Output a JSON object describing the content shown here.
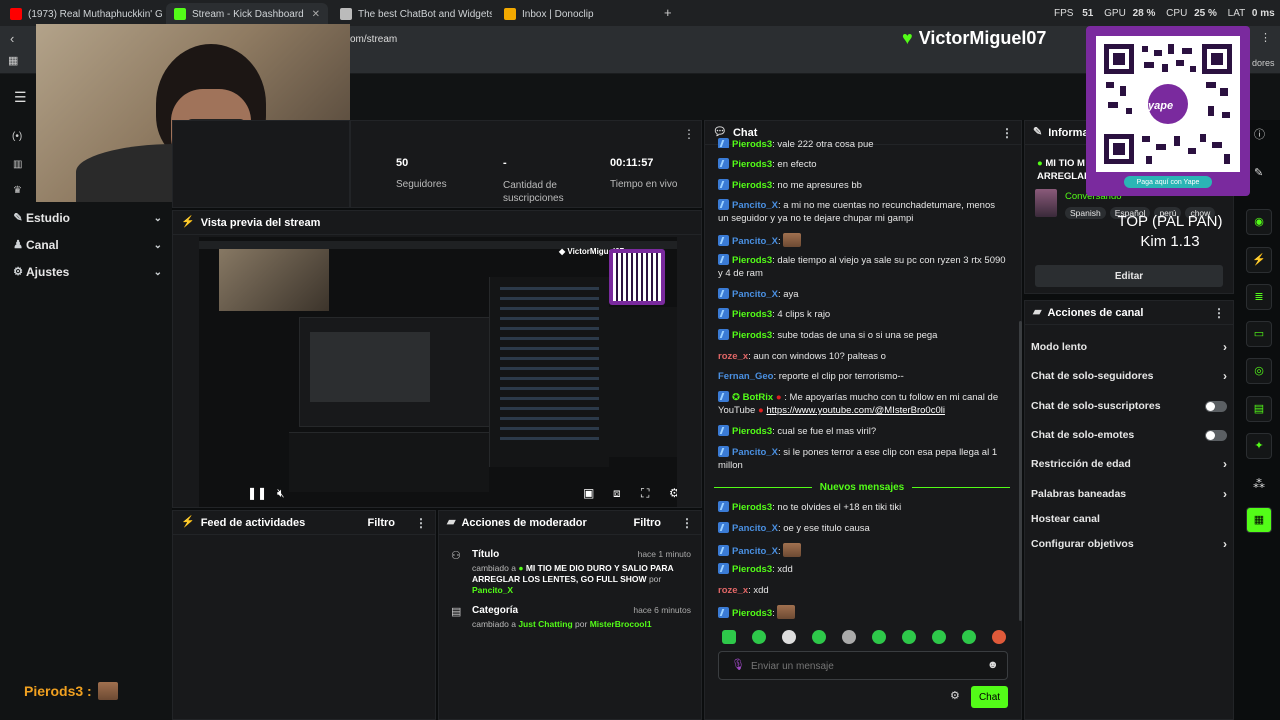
{
  "browser": {
    "tabs": [
      {
        "label": "(1973) Real Muthaphuckkin' G's",
        "color": "#ff0000"
      },
      {
        "label": "Stream - Kick Dashboard",
        "color": "#53fc18"
      },
      {
        "label": "The best ChatBot and Widgets for Ki",
        "color": "#bbbbbb"
      },
      {
        "label": "Inbox | Donoclip",
        "color": "#f2a900"
      }
    ],
    "address": "om/stream",
    "bookmark_right": "dores",
    "hud": {
      "fps_label": "FPS",
      "fps": "51",
      "gpu_label": "GPU",
      "gpu": "28 %",
      "cpu_label": "CPU",
      "cpu": "25 %",
      "lat_label": "LAT",
      "lat": "0 ms"
    }
  },
  "overlay": {
    "channel_name": "VictorMiguel07",
    "qr_caption": "Paga aquí con Yape",
    "qr_brand": "yape",
    "top_text": "TOP (PAL PAN)",
    "top_sub": "Kim 1.13"
  },
  "sidebar": {
    "items": [
      {
        "label": "Estudio",
        "icon": "palette-icon"
      },
      {
        "label": "Canal",
        "icon": "user-icon"
      },
      {
        "label": "Ajustes",
        "icon": "gear-icon"
      }
    ],
    "bottom_user": "Pierods3 :"
  },
  "stats": {
    "followers_value": "50",
    "followers_label": "Seguidores",
    "subs_value": "-",
    "subs_label": "Cantidad de suscripciones",
    "live_value": "00:11:57",
    "live_label": "Tiempo en vivo"
  },
  "preview": {
    "title": "Vista previa del stream"
  },
  "activity": {
    "title": "Feed de actividades",
    "filter": "Filtro"
  },
  "moderator": {
    "title": "Acciones de moderador",
    "filter": "Filtro",
    "entries": [
      {
        "heading": "Título",
        "time": "hace 1 minuto",
        "prefix": "cambiado a",
        "value": "MI TIO ME DIO DURO Y SALIO PARA ARREGLAR LOS LENTES, GO FULL SHOW",
        "by": "por",
        "user": "Pancito_X"
      },
      {
        "heading": "Categoría",
        "time": "hace 6 minutos",
        "prefix": "cambiado a",
        "value": "Just Chatting",
        "by": "por",
        "user": "MisterBrocool1"
      }
    ]
  },
  "chat": {
    "title": "Chat",
    "new_messages": "Nuevos mensajes",
    "input_placeholder": "Enviar un mensaje",
    "send_label": "Chat",
    "messages": [
      {
        "user": "Pierods3",
        "text": ": vale 222 otra cosa pue"
      },
      {
        "user": "Pierods3",
        "text": ": en efecto"
      },
      {
        "user": "Pierods3",
        "text": ": no me apresures bb"
      },
      {
        "user": "Pancito_X",
        "text": ": a mi no me cuentas no recunchadetumare, menos un seguidor y ya no te dejare chupar mi gampi"
      },
      {
        "user": "Pancito_X",
        "text": ":"
      },
      {
        "user": "Pierods3",
        "text": ": dale tiempo al viejo ya sale su pc con ryzen 3 rtx 5090 y 4 de ram"
      },
      {
        "user": "Pancito_X",
        "text": ": aya"
      },
      {
        "user": "Pierods3",
        "text": ": 4 clips k rajo"
      },
      {
        "user": "Pierods3",
        "text": ": sube todas de una si o si una se pega"
      },
      {
        "user": "roze_x",
        "text": ": aun con windows 10? palteas o"
      },
      {
        "user": "Fernan_Geo",
        "text": ": reporte el clip por terrorismo--"
      },
      {
        "user": "BotRix",
        "text": ": Me apoyarías mucho con tu follow en mi canal de YouTube",
        "link": "https://www.youtube.com/@MIsterBro0c0li"
      },
      {
        "user": "Pierods3",
        "text": ": cual se fue el mas viril?"
      },
      {
        "user": "Pancito_X",
        "text": ": si le pones terror a ese clip con esa pepa llega al 1 millon"
      },
      {
        "user": "Pierods3",
        "text": ": no te olvides el +18 en tiki tiki"
      },
      {
        "user": "Pancito_X",
        "text": ": oe y ese titulo causa"
      },
      {
        "user": "Pancito_X",
        "text": ":"
      },
      {
        "user": "Pierods3",
        "text": ": xdd"
      },
      {
        "user": "roze_x",
        "text": ": xdd"
      },
      {
        "user": "Pierods3",
        "text": ":"
      }
    ]
  },
  "info": {
    "title": "Informac",
    "stream_title": "MI TIO M ARREGLAR",
    "category": "Conversando",
    "tags": [
      "Spanish",
      "Español",
      "perú",
      "chow"
    ],
    "edit_label": "Editar"
  },
  "channel_actions": {
    "title": "Acciones de canal",
    "rows": [
      {
        "label": "Modo lento",
        "control": "chevron"
      },
      {
        "label": "Chat de solo-seguidores",
        "control": "chevron"
      },
      {
        "label": "Chat de solo-suscriptores",
        "control": "toggle"
      },
      {
        "label": "Chat de solo-emotes",
        "control": "toggle"
      },
      {
        "label": "Restricción de edad",
        "control": "chevron"
      },
      {
        "label": "Palabras baneadas",
        "control": "chevron"
      },
      {
        "label": "Hostear canal",
        "control": "none"
      },
      {
        "label": "Configurar objetivos",
        "control": "chevron"
      }
    ]
  },
  "colors": {
    "accent": "#53fc18",
    "panel": "#18191b",
    "bg": "#0b0d0e",
    "qr": "#7a2a9e"
  }
}
